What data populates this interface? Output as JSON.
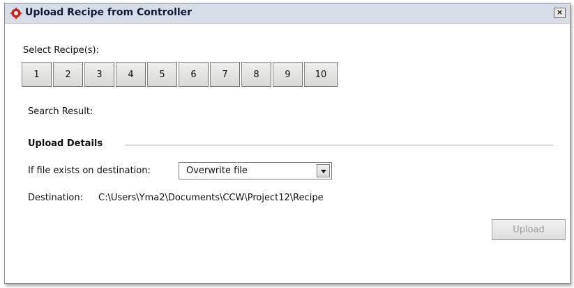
{
  "window": {
    "title": "Upload Recipe from Controller",
    "close_label": "×"
  },
  "recipes": {
    "label": "Select Recipe(s):",
    "buttons": [
      "1",
      "2",
      "3",
      "4",
      "5",
      "6",
      "7",
      "8",
      "9",
      "10"
    ]
  },
  "search": {
    "label": "Search Result:"
  },
  "upload_details": {
    "title": "Upload Details",
    "if_exists_label": "If file exists on destination:",
    "if_exists_value": "Overwrite file",
    "destination_label": "Destination:",
    "destination_path": "C:\\Users\\Yma2\\Documents\\CCW\\Project12\\Recipe"
  },
  "actions": {
    "upload_label": "Upload",
    "upload_enabled": false
  },
  "colors": {
    "title_bar": "#d6dde7",
    "title_text": "#0c1a3c",
    "disabled_text": "#9b9b9b"
  },
  "icons": {
    "app": "recipe-app-icon",
    "close": "close-icon",
    "dropdown": "chevron-down-icon"
  }
}
